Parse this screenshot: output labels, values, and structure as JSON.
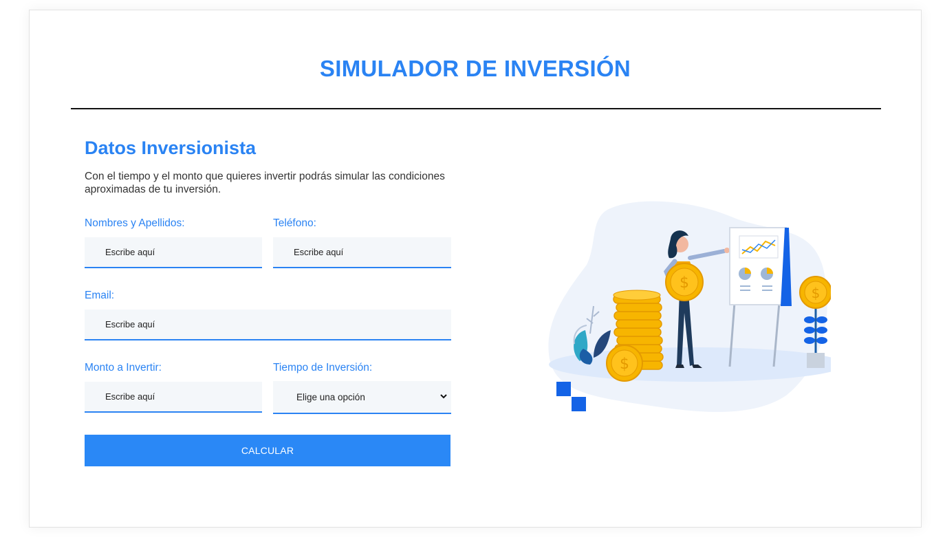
{
  "header": {
    "title": "SIMULADOR DE INVERSIÓN"
  },
  "form": {
    "title": "Datos Inversionista",
    "description": "Con el tiempo y el monto que quieres invertir podrás simular las condiciones aproximadas de tu inversión.",
    "fields": {
      "name": {
        "label": "Nombres y Apellidos:",
        "placeholder": "Escribe aquí"
      },
      "phone": {
        "label": "Teléfono:",
        "placeholder": "Escribe aquí"
      },
      "email": {
        "label": "Email:",
        "placeholder": "Escribe aquí"
      },
      "amount": {
        "label": "Monto a Invertir:",
        "placeholder": "Escribe aquí"
      },
      "term": {
        "label": "Tiempo de Inversión:",
        "selected": "Elige una opción"
      }
    },
    "submit_label": "CALCULAR"
  },
  "illustration": {
    "icon": "investment-woman-coins-illustration"
  },
  "colors": {
    "accent": "#2a83f3",
    "input_bg": "#f4f7fa",
    "button": "#2a88f6",
    "coin": "#f7b500"
  }
}
